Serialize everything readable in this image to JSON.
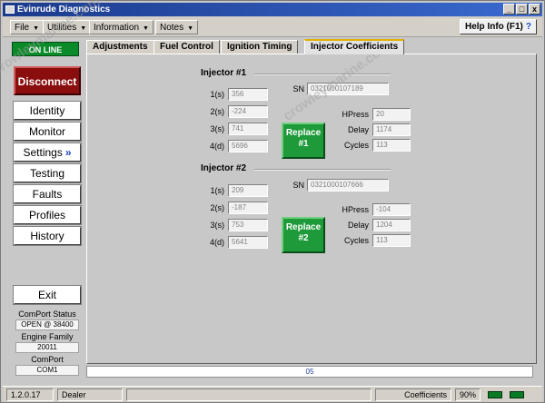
{
  "window": {
    "title": "Evinrude Diagnostics",
    "btn_min": "_",
    "btn_max": "□",
    "btn_close": "x"
  },
  "menu": {
    "file": "File",
    "utilities": "Utilities",
    "information": "Information",
    "notes": "Notes",
    "help": "Help Info (F1)",
    "help_icon": "?"
  },
  "sidebar": {
    "status": "ON LINE",
    "disconnect": "Disconnect",
    "items": [
      {
        "label": "Identity"
      },
      {
        "label": "Monitor"
      },
      {
        "label": "Settings",
        "chevron": "»"
      },
      {
        "label": "Testing"
      },
      {
        "label": "Faults"
      },
      {
        "label": "Profiles"
      },
      {
        "label": "History"
      }
    ],
    "exit": "Exit",
    "comport_status_label": "ComPort Status",
    "comport_status_value": "OPEN @ 38400",
    "engine_family_label": "Engine Family",
    "engine_family_value": "20011",
    "comport_label": "ComPort",
    "comport_value": "COM1"
  },
  "tabs": [
    {
      "label": "Adjustments"
    },
    {
      "label": "Fuel Control"
    },
    {
      "label": "Ignition Timing"
    },
    {
      "label": "Injector Coefficients",
      "active": true
    }
  ],
  "injector1": {
    "title": "Injector #1",
    "sn_label": "SN",
    "sn": "0321000107189",
    "t_labels": [
      "1(s)",
      "2(s)",
      "3(s)",
      "4(d)"
    ],
    "t_values": [
      "356",
      "-224",
      "741",
      "5696"
    ],
    "replace_line1": "Replace",
    "replace_line2": "#1",
    "hpress_label": "HPress",
    "hpress": "20",
    "delay_label": "Delay",
    "delay": "1174",
    "cycles_label": "Cycles",
    "cycles": "113"
  },
  "injector2": {
    "title": "Injector #2",
    "sn_label": "SN",
    "sn": "0321000107666",
    "t_labels": [
      "1(s)",
      "2(s)",
      "3(s)",
      "4(d)"
    ],
    "t_values": [
      "209",
      "-187",
      "753",
      "5641"
    ],
    "replace_line1": "Replace",
    "replace_line2": "#2",
    "hpress_label": "HPress",
    "hpress": "-104",
    "delay_label": "Delay",
    "delay": "1204",
    "cycles_label": "Cycles",
    "cycles": "113"
  },
  "bottom_strip": "05",
  "statusbar": {
    "version": "1.2.0.17",
    "user": "Dealer",
    "screen": "Coefficients",
    "percent": "90%"
  },
  "colors": {
    "online_green": "#0b8a2a",
    "disconnect_red": "#8b0e0e",
    "replace_green": "#1e9a3a",
    "titlebar_blue": "#1b3a8c"
  },
  "watermark": "crowleymarine.com"
}
